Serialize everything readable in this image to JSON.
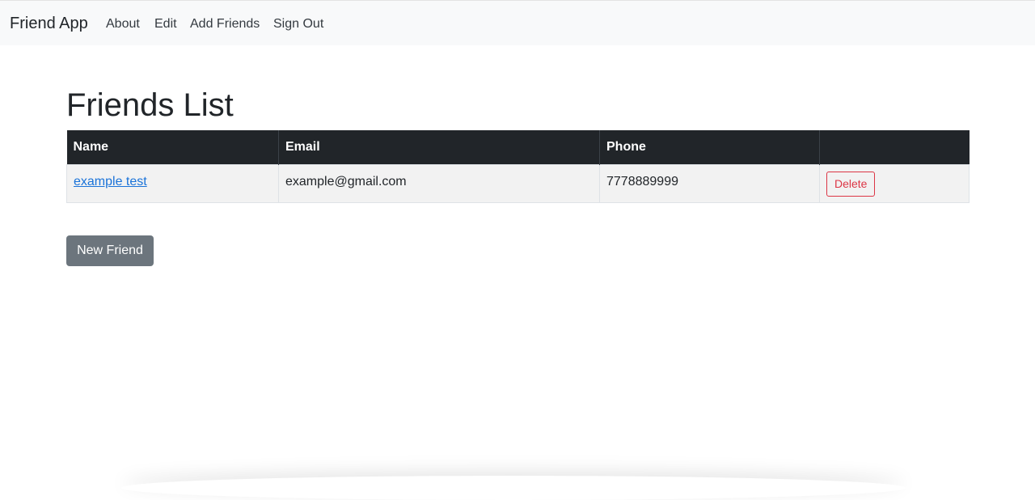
{
  "navbar": {
    "brand": "Friend App",
    "links": [
      {
        "label": "About"
      },
      {
        "label": "Edit"
      },
      {
        "label": "Add Friends"
      },
      {
        "label": "Sign Out"
      }
    ]
  },
  "main": {
    "title": "Friends List",
    "table": {
      "headers": [
        "Name",
        "Email",
        "Phone",
        ""
      ],
      "rows": [
        {
          "name": "example test",
          "email": "example@gmail.com",
          "phone": "7778889999",
          "action_label": "Delete"
        }
      ]
    },
    "new_friend_label": "New Friend"
  },
  "colors": {
    "navbar_bg": "#f8f9fa",
    "table_header_bg": "#212529",
    "row_bg": "#f2f2f2",
    "link": "#1a73d9",
    "danger": "#dc3545",
    "secondary_button": "#6c757d"
  }
}
